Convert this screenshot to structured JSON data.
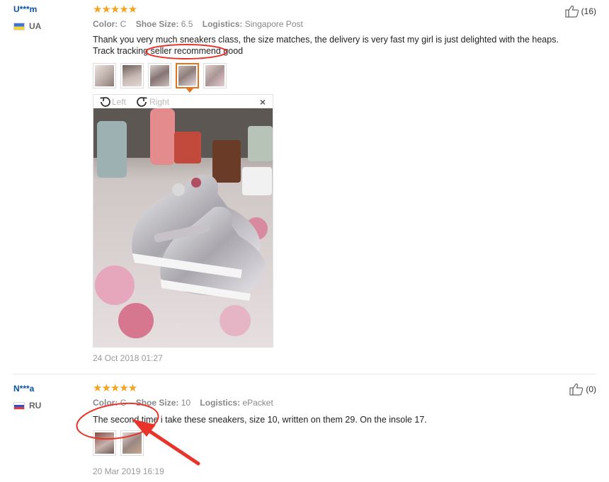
{
  "reviews": [
    {
      "user": "U***m",
      "country": "UA",
      "color_key": "Color:",
      "color_val": "C",
      "size_key": "Shoe Size:",
      "size_val": "6.5",
      "logistics_key": "Logistics:",
      "logistics_val": "Singapore Post",
      "text": "Thank you very much sneakers class, the size matches, the delivery is very fast my girl is just delighted with the heaps. Track tracking seller recommend good",
      "helpful_count": "(16)",
      "date": "24 Oct 2018 01:27",
      "viewer": {
        "rotate_left": "Left",
        "rotate_right": "Right",
        "close": "×"
      }
    },
    {
      "user": "N***a",
      "country": "RU",
      "color_key": "Color:",
      "color_val": "C",
      "size_key": "Shoe Size:",
      "size_val": "10",
      "logistics_key": "Logistics:",
      "logistics_val": "ePacket",
      "text": "The second time i take these sneakers, size 10, written on them 29. On the insole 17.",
      "helpful_count": "(0)",
      "date": "20 Mar 2019 16:19"
    }
  ],
  "stars": "★★★★★",
  "icons": [
    "thumbs-up-icon",
    "rotate-left-icon",
    "rotate-right-icon",
    "close-icon",
    "star-icon",
    "flag-icon"
  ],
  "colors": {
    "link": "#0b52a5",
    "star": "#f4a31f",
    "active_thumb": "#e3741e",
    "annotation": "#e8352b"
  }
}
